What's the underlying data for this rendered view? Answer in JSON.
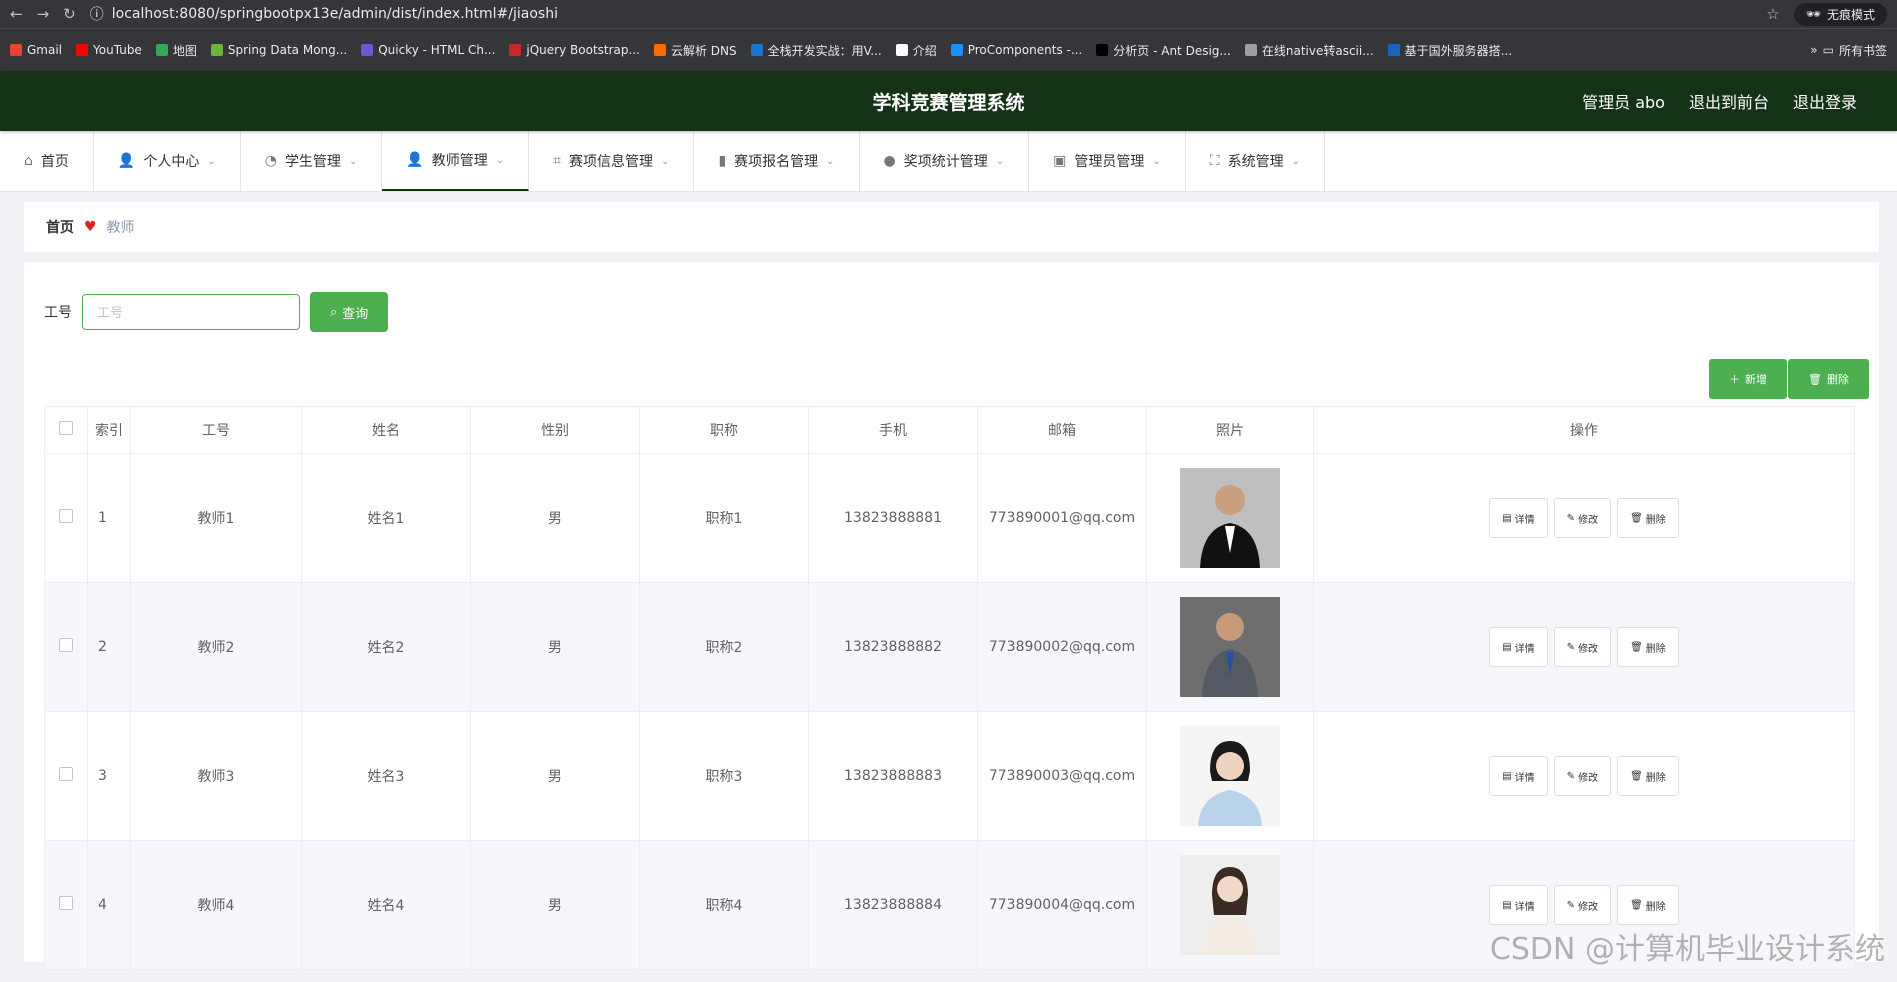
{
  "browser": {
    "url": "localhost:8080/springbootpx13e/admin/dist/index.html#/jiaoshi",
    "incognito_label": "无痕模式",
    "bookmarks": [
      {
        "label": "Gmail",
        "color": "#ea4335"
      },
      {
        "label": "YouTube",
        "color": "#ff0000"
      },
      {
        "label": "地图",
        "color": "#34a853"
      },
      {
        "label": "Spring Data Mong...",
        "color": "#6db33f"
      },
      {
        "label": "Quicky - HTML Ch...",
        "color": "#6a5acd"
      },
      {
        "label": "jQuery Bootstrap...",
        "color": "#c62828"
      },
      {
        "label": "云解析 DNS",
        "color": "#ff6a00"
      },
      {
        "label": "全栈开发实战：用V...",
        "color": "#1976d2"
      },
      {
        "label": "介绍",
        "color": "#ffffff"
      },
      {
        "label": "ProComponents -...",
        "color": "#1890ff"
      },
      {
        "label": "分析页 - Ant Desig...",
        "color": "#000000"
      },
      {
        "label": "在线native转ascii...",
        "color": "#9e9e9e"
      },
      {
        "label": "基于国外服务器搭...",
        "color": "#1565c0"
      }
    ],
    "all_bookmarks": "所有书签"
  },
  "header": {
    "title": "学科竞赛管理系统",
    "admin": "管理员 abo",
    "to_front": "退出到前台",
    "logout": "退出登录"
  },
  "menu": [
    {
      "label": "首页",
      "icon": "home-icon",
      "dropdown": false
    },
    {
      "label": "个人中心",
      "icon": "user-icon",
      "dropdown": true
    },
    {
      "label": "学生管理",
      "icon": "gauge-icon",
      "dropdown": true
    },
    {
      "label": "教师管理",
      "icon": "user-icon",
      "dropdown": true,
      "active": true
    },
    {
      "label": "赛项信息管理",
      "icon": "crop-icon",
      "dropdown": true
    },
    {
      "label": "赛项报名管理",
      "icon": "bar-chart-icon",
      "dropdown": true
    },
    {
      "label": "奖项统计管理",
      "icon": "balloon-icon",
      "dropdown": true
    },
    {
      "label": "管理员管理",
      "icon": "clipboard-icon",
      "dropdown": true
    },
    {
      "label": "系统管理",
      "icon": "fullscreen-icon",
      "dropdown": true
    }
  ],
  "breadcrumb": {
    "home": "首页",
    "current": "教师"
  },
  "search": {
    "label": "工号",
    "placeholder": "工号",
    "button": "查询"
  },
  "actions": {
    "add": "新增",
    "delete": "删除"
  },
  "table": {
    "headers": [
      "索引",
      "工号",
      "姓名",
      "性别",
      "职称",
      "手机",
      "邮箱",
      "照片",
      "操作"
    ],
    "rows": [
      {
        "index": "1",
        "gonghao": "教师1",
        "name": "姓名1",
        "gender": "男",
        "title": "职称1",
        "phone": "13823888881",
        "email": "773890001@qq.com"
      },
      {
        "index": "2",
        "gonghao": "教师2",
        "name": "姓名2",
        "gender": "男",
        "title": "职称2",
        "phone": "13823888882",
        "email": "773890002@qq.com"
      },
      {
        "index": "3",
        "gonghao": "教师3",
        "name": "姓名3",
        "gender": "男",
        "title": "职称3",
        "phone": "13823888883",
        "email": "773890003@qq.com"
      },
      {
        "index": "4",
        "gonghao": "教师4",
        "name": "姓名4",
        "gender": "男",
        "title": "职称4",
        "phone": "13823888884",
        "email": "773890004@qq.com"
      }
    ],
    "op_labels": {
      "detail": "详情",
      "edit": "修改",
      "delete": "删除"
    }
  },
  "watermark": "CSDN @计算机毕业设计系统",
  "colors": {
    "header_bg": "#133216",
    "accent": "#4caf50"
  }
}
